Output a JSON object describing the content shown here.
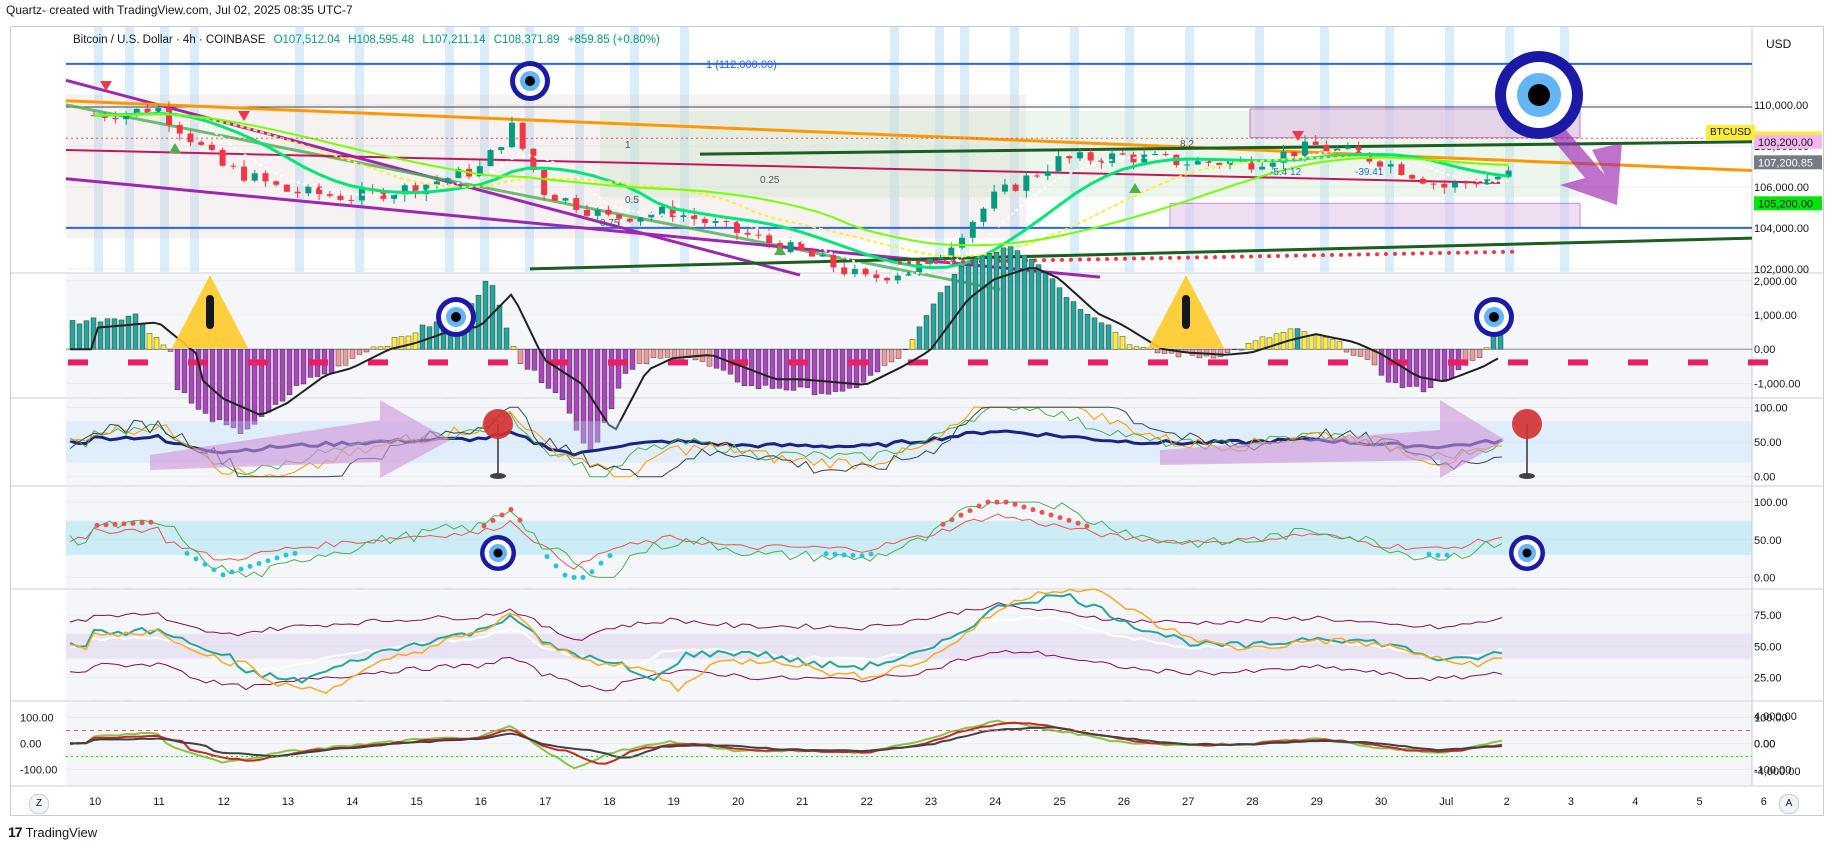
{
  "caption": "Quartz- created with TradingView.com, Jul 02, 2025 08:35 UTC-7",
  "legend": {
    "symbol": "Bitcoin / U.S. Dollar · 4h · COINBASE",
    "open": "O107,512.04",
    "high": "H108,595.48",
    "low": "L107,211.14",
    "close": "C108,371.89",
    "change": "+859.85 (+0.80%)"
  },
  "currency": "USD",
  "fib_label": "1 (112,000.00)",
  "ticker_badge": "BTCUSD",
  "price_badges": [
    {
      "text": "108,371.89",
      "bg": "#ffeb3b",
      "fg": "#131722",
      "price": 108371.89
    },
    {
      "text": "108,200.00",
      "bg": "#f4b6f0",
      "fg": "#131722",
      "price": 108200
    },
    {
      "text": "107,200.85",
      "bg": "#787b86",
      "fg": "#ffffff",
      "price": 107200.85
    },
    {
      "text": "105,200.00",
      "bg": "#00e600",
      "fg": "#131722",
      "price": 105200
    }
  ],
  "footer": {
    "brand": "TradingView",
    "left_button": "Z",
    "right_button": "A"
  },
  "colors": {
    "bull": "#089981",
    "bear": "#f23645",
    "purple": "#9c27b0",
    "orange": "#ff9800",
    "green": "#4caf50",
    "darkgreen": "#1b5e20",
    "blue": "#2962ff",
    "navy": "#1a237e"
  },
  "icons": [
    "evil-eye-icon",
    "warning-icon",
    "pin-marker-icon",
    "tradingview-logo-icon"
  ],
  "chart_data": [
    {
      "type": "candlestick",
      "title": "Bitcoin / U.S. Dollar",
      "timeframe": "4h",
      "x_ticks": [
        "10",
        "11",
        "12",
        "13",
        "14",
        "15",
        "16",
        "17",
        "18",
        "19",
        "20",
        "21",
        "22",
        "23",
        "24",
        "25",
        "26",
        "27",
        "28",
        "29",
        "30",
        "Jul",
        "2",
        "3",
        "4",
        "5",
        "6"
      ],
      "y_ticks": [
        102000,
        104000,
        106000,
        108000,
        110000
      ],
      "y_tick_labels": [
        "102,000.00",
        "104,000.00",
        "106,000.00",
        "108,000.00",
        "110,000.00"
      ],
      "ylim": [
        101850,
        113800
      ],
      "approx_close_path": [
        {
          "day": 10,
          "close": 109500
        },
        {
          "day": 11,
          "close": 109800
        },
        {
          "day": 12,
          "close": 107000
        },
        {
          "day": 13,
          "close": 105800
        },
        {
          "day": 14,
          "close": 105500
        },
        {
          "day": 15,
          "close": 106000
        },
        {
          "day": 16,
          "close": 106900
        },
        {
          "day": 16.5,
          "close": 108900
        },
        {
          "day": 17,
          "close": 105800
        },
        {
          "day": 18,
          "close": 104500
        },
        {
          "day": 19,
          "close": 104800
        },
        {
          "day": 20,
          "close": 103800
        },
        {
          "day": 21,
          "close": 102800
        },
        {
          "day": 22,
          "close": 101500
        },
        {
          "day": 23,
          "close": 102200
        },
        {
          "day": 24,
          "close": 105500
        },
        {
          "day": 25,
          "close": 107300
        },
        {
          "day": 26,
          "close": 107500
        },
        {
          "day": 27,
          "close": 107200
        },
        {
          "day": 28,
          "close": 107200
        },
        {
          "day": 29,
          "close": 108000
        },
        {
          "day": 30,
          "close": 107300
        },
        {
          "day": 31,
          "close": 106000
        },
        {
          "day": 32,
          "close": 106600
        },
        {
          "day": 32.15,
          "close": 108371.89
        }
      ],
      "annotations": [
        "1",
        "0.25",
        "0.5",
        "0.75",
        "8.2",
        "-5.4 12",
        "-39.41"
      ]
    },
    {
      "type": "histogram",
      "title": "",
      "y_ticks": [
        -1000,
        0,
        1000,
        2000
      ],
      "y_tick_labels": [
        "-1,000.00",
        "0.00",
        "1,000.00",
        "2,000.00"
      ],
      "ylim": [
        -1400,
        2200
      ]
    },
    {
      "type": "line",
      "title": "",
      "y_ticks": [
        0,
        50,
        100
      ],
      "y_tick_labels": [
        "0.00",
        "50.00",
        "100.00"
      ],
      "ylim": [
        -12,
        112
      ]
    },
    {
      "type": "line",
      "title": "",
      "y_ticks": [
        0,
        50,
        100
      ],
      "y_tick_labels": [
        "0.00",
        "50.00",
        "100.00"
      ],
      "ylim": [
        -14,
        120
      ]
    },
    {
      "type": "line",
      "title": "",
      "y_ticks": [
        25,
        50,
        75
      ],
      "y_tick_labels": [
        "25.00",
        "50.00",
        "75.00"
      ],
      "ylim": [
        7,
        95
      ]
    },
    {
      "type": "area",
      "title": "",
      "y_ticks": [
        -100,
        0,
        100
      ],
      "y_tick_labels": [
        "-100.00",
        "0.00",
        "100.00"
      ],
      "y_ticks_right": [
        -4000,
        0,
        4000
      ],
      "y_tick_labels_right": [
        "-4,000.00",
        "0.00",
        "4,000.00"
      ],
      "ylim": [
        -160,
        160
      ]
    }
  ]
}
